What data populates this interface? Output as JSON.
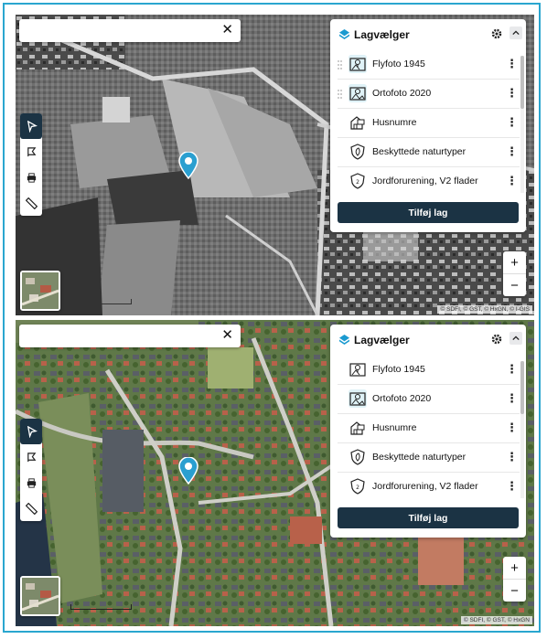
{
  "layer_panel": {
    "title": "Lagvælger",
    "add_button": "Tilføj lag",
    "layers": [
      {
        "label": "Flyfoto 1945",
        "icon": "aerial-photo-icon"
      },
      {
        "label": "Ortofoto 2020",
        "icon": "orthophoto-icon"
      },
      {
        "label": "Husnumre",
        "icon": "house-number-icon"
      },
      {
        "label": "Beskyttede naturtyper",
        "icon": "nature-protection-icon"
      },
      {
        "label": "Jordforurening, V2 flader",
        "icon": "soil-pollution-icon"
      }
    ]
  },
  "top_panel": {
    "attribution": "© SDFI, © GST, © HxGN, © I-GIS",
    "selected_layer": "Flyfoto 1945"
  },
  "bottom_panel": {
    "attribution": "© SDFI, © GST, © HxGN",
    "selected_layer": "Ortofoto 2020"
  },
  "search": {
    "placeholder": "",
    "value": "",
    "clear_label": "✕"
  },
  "zoom": {
    "in_label": "+",
    "out_label": "−"
  },
  "colors": {
    "accent": "#1b3344",
    "frame": "#2aa6cf",
    "pin": "#2a9fd0",
    "logo": "#1a9ad0"
  }
}
